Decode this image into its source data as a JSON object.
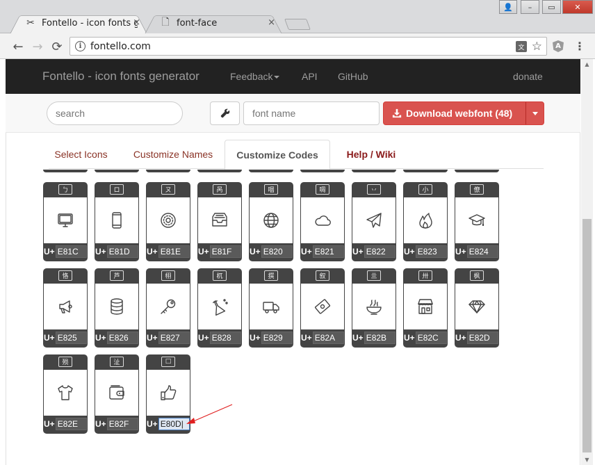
{
  "browser": {
    "tabs": [
      {
        "title": "Fontello - icon fonts ge",
        "close": "×",
        "active": true
      },
      {
        "title": "font-face",
        "close": "×",
        "active": false
      }
    ],
    "window_controls": {
      "user": "👤",
      "minimize": "–",
      "maximize": "▭",
      "close": "✕"
    },
    "nav": {
      "back": "←",
      "forward": "→",
      "reload": "⟳"
    },
    "url": "fontello.com",
    "star": "☆",
    "menu": "⋮"
  },
  "navbar": {
    "brand": "Fontello - icon fonts generator",
    "links": {
      "feedback": "Feedback",
      "api": "API",
      "github": "GitHub",
      "donate": "donate"
    }
  },
  "toolbar": {
    "search_placeholder": "search",
    "fontname_placeholder": "font name",
    "download_label": "Download webfont (48)"
  },
  "page_tabs": {
    "select": "Select Icons",
    "names": "Customize Names",
    "codes": "Customize Codes",
    "help": "Help / Wiki"
  },
  "glyphs": {
    "prefix": "U+",
    "rows": [
      [
        {
          "char": "ㄅ",
          "icon": "monitor-icon",
          "code": "E81C"
        },
        {
          "char": "ロ",
          "icon": "mobile-icon",
          "code": "E81D"
        },
        {
          "char": "ㄡ",
          "icon": "disc-icon",
          "code": "E81E"
        },
        {
          "char": "呙",
          "icon": "inbox-icon",
          "code": "E81F"
        },
        {
          "char": "咽",
          "icon": "globe-icon",
          "code": "E820"
        },
        {
          "char": "啁",
          "icon": "cloud-icon",
          "code": "E821"
        },
        {
          "char": "丷",
          "icon": "paper-plane-icon",
          "code": "E822"
        },
        {
          "char": "小",
          "icon": "fire-icon",
          "code": "E823"
        },
        {
          "char": "僚",
          "icon": "graduation-cap-icon",
          "code": "E824"
        }
      ],
      [
        {
          "char": "恪",
          "icon": "megaphone-icon",
          "code": "E825"
        },
        {
          "char": "芦",
          "icon": "database-icon",
          "code": "E826"
        },
        {
          "char": "栩",
          "icon": "key-icon",
          "code": "E827"
        },
        {
          "char": "杌",
          "icon": "flask-icon",
          "code": "E828"
        },
        {
          "char": "撰",
          "icon": "truck-icon",
          "code": "E829"
        },
        {
          "char": "叙",
          "icon": "money-icon",
          "code": "E82A"
        },
        {
          "char": "亖",
          "icon": "food-bowl-icon",
          "code": "E82B"
        },
        {
          "char": "卅",
          "icon": "shop-icon",
          "code": "E82C"
        },
        {
          "char": "枫",
          "icon": "diamond-icon",
          "code": "E82D"
        }
      ],
      [
        {
          "char": "殒",
          "icon": "t-shirt-icon",
          "code": "E82E"
        },
        {
          "char": "沚",
          "icon": "wallet-icon",
          "code": "E82F"
        },
        {
          "char": "□",
          "icon": "thumbs-up-icon",
          "code": "E80D",
          "editing": true
        }
      ]
    ]
  },
  "colors": {
    "navbar_bg": "#222222",
    "download_btn": "#d9534f",
    "active_tab_text": "#555555",
    "tab_text": "#8a3326",
    "annotation_arrow": "#e02020"
  }
}
